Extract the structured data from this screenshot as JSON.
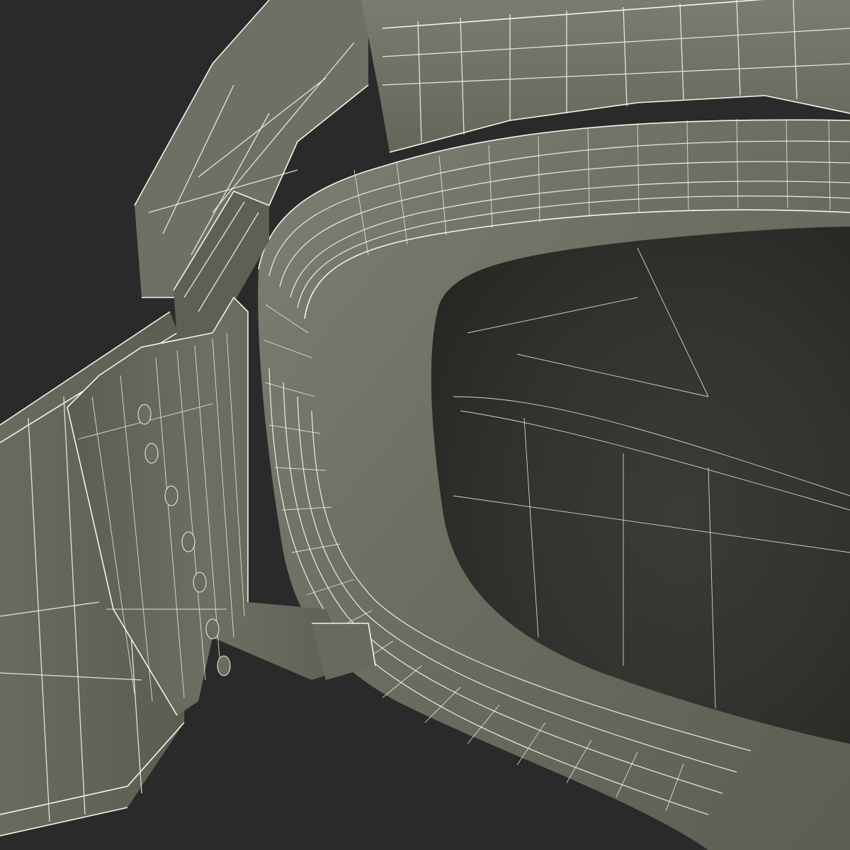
{
  "scene": {
    "subject": "wireframe-render",
    "colors": {
      "background": "#2a2a2a",
      "mesh_base": "#6d6e62",
      "mesh_light": "#7d7e72",
      "mesh_dark": "#54554b",
      "lens_dark": "#2e302b",
      "wire": "#f2f2e4"
    }
  }
}
